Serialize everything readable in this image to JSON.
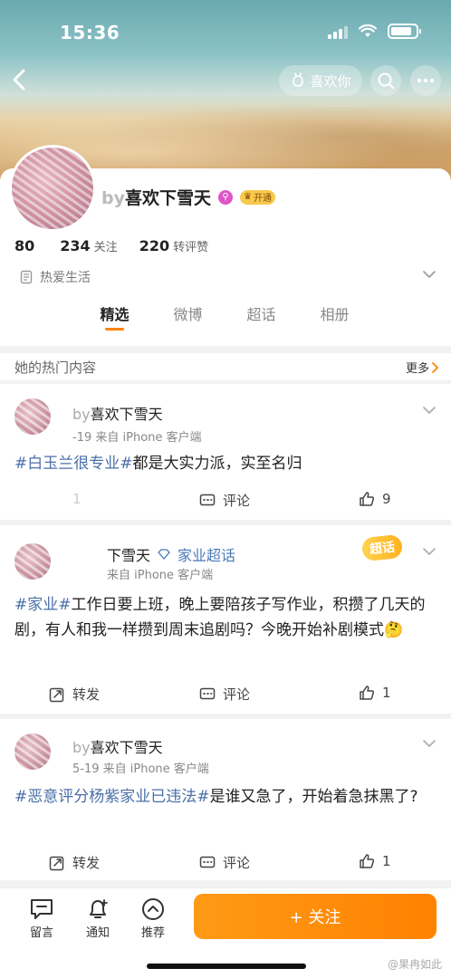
{
  "status": {
    "time": "15:36"
  },
  "header": {
    "like_label": "喜欢你"
  },
  "profile": {
    "name_prefix": "by",
    "name": "喜欢下雪天",
    "vip_label": "开通",
    "stats": [
      {
        "value": "80",
        "label": ""
      },
      {
        "value": "234",
        "label": "关注"
      },
      {
        "value": "220",
        "label": "转评赞"
      }
    ],
    "bio": "热爱生活"
  },
  "tabs": [
    "精选",
    "微博",
    "超话",
    "相册"
  ],
  "section": {
    "title": "她的热门内容",
    "more": "更多"
  },
  "posts": [
    {
      "name_prefix": "by",
      "name": "喜欢下雪天",
      "meta_date": "-19",
      "meta_source": "来自 iPhone 客户端",
      "tag": "#白玉兰很专业#",
      "text": "都是大实力派，实至名归",
      "repost_count": "1",
      "comment_label": "评论",
      "like_count": "9"
    },
    {
      "name": "下雪天",
      "supertopic": "家业超话",
      "meta_source": "来自 iPhone 客户端",
      "badge": "超话",
      "tag": "#家业#",
      "text": "工作日要上班，晚上要陪孩子写作业，积攒了几天的剧，有人和我一样攒到周末追剧吗？今晚开始补剧模式🤔",
      "repost_label": "转发",
      "comment_label": "评论",
      "like_count": "1"
    },
    {
      "name_prefix": "by",
      "name": "喜欢下雪天",
      "meta_date": "5-19",
      "meta_source": "来自 iPhone 客户端",
      "tag": "#恶意评分杨紫家业已违法#",
      "text": "是谁又急了，开始着急抹黑了?",
      "repost_label": "转发",
      "comment_label": "评论",
      "like_count": "1"
    }
  ],
  "bottom": {
    "message_label": "留言",
    "notify_label": "通知",
    "recommend_label": "推荐",
    "follow_label": "+ 关注"
  },
  "watermark": "@果冉如此",
  "colors": {
    "accent": "#ff8200",
    "tag": "#4a6fa8"
  }
}
